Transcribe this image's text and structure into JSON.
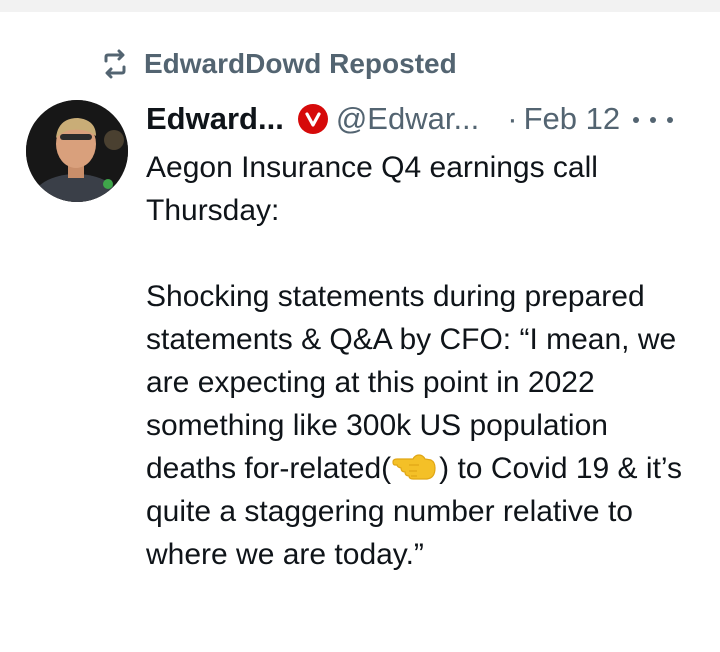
{
  "repost": {
    "icon": "repost-icon",
    "label": "EdwardDowd Reposted"
  },
  "post": {
    "author_name": "Edward...",
    "verified_badge_icon": "verified-badge-icon",
    "verified_badge_letter": "V",
    "handle": "@Edwar...",
    "separator": "·",
    "date": "Feb 12",
    "more_icon": "more-options-icon",
    "text_paragraph_1": "Aegon Insurance Q4 earnings call Thursday:",
    "text_paragraph_2_before_emoji": "Shocking statements during prepared statements & Q&A by CFO: “I mean, we are expecting at this point in 2022 something like 300k US population deaths for-related(",
    "emoji_icon": "pointing-left-hand-emoji",
    "text_paragraph_2_after_emoji": ") to Covid 19 & it’s quite a staggering number relative to where we are today.”"
  },
  "colors": {
    "muted": "#536471",
    "text": "#0f1419",
    "badge": "#d60a0a",
    "emoji": "#f4c027"
  }
}
